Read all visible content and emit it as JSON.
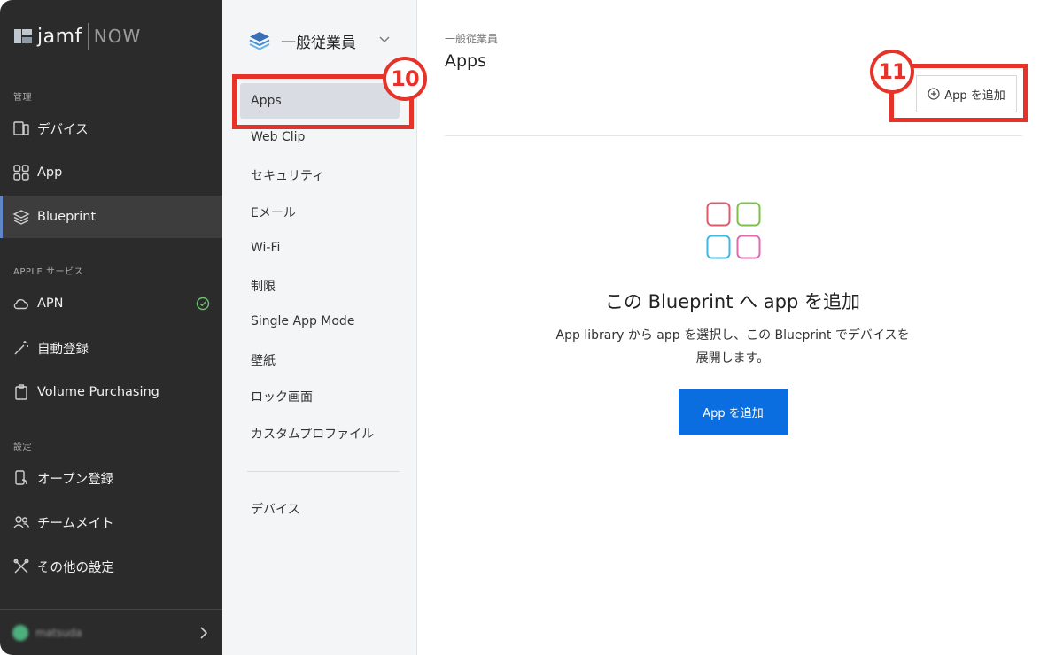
{
  "logo": {
    "brand": "jamf",
    "product": "NOW"
  },
  "sidebar": {
    "sections": {
      "manage": "管理",
      "apple": "APPLE サービス",
      "settings": "設定"
    },
    "items": {
      "devices": "デバイス",
      "app": "App",
      "blueprint": "Blueprint",
      "apn": "APN",
      "auto_enroll": "自動登録",
      "vpp": "Volume Purchasing",
      "open_enroll": "オープン登録",
      "teammates": "チームメイト",
      "other_settings": "その他の設定"
    },
    "user": "matsuda"
  },
  "midpanel": {
    "blueprint_name": "一般従業員",
    "items": [
      "Apps",
      "Web Clip",
      "セキュリティ",
      "Eメール",
      "Wi-Fi",
      "制限",
      "Single App Mode",
      "壁紙",
      "ロック画面",
      "カスタムプロファイル"
    ],
    "devices": "デバイス"
  },
  "main": {
    "breadcrumb": "一般従業員",
    "title": "Apps",
    "add_app_top": "App を追加",
    "empty_title": "この Blueprint へ app を追加",
    "empty_desc": "App library から app を選択し、この Blueprint でデバイスを展開します。",
    "add_app_main": "App を追加"
  },
  "annotations": {
    "step10": "10",
    "step11": "11"
  },
  "colors": {
    "accent": "#0a6ee0",
    "annotation": "#e5332a",
    "sidebar_bg": "#2b2b2b"
  }
}
